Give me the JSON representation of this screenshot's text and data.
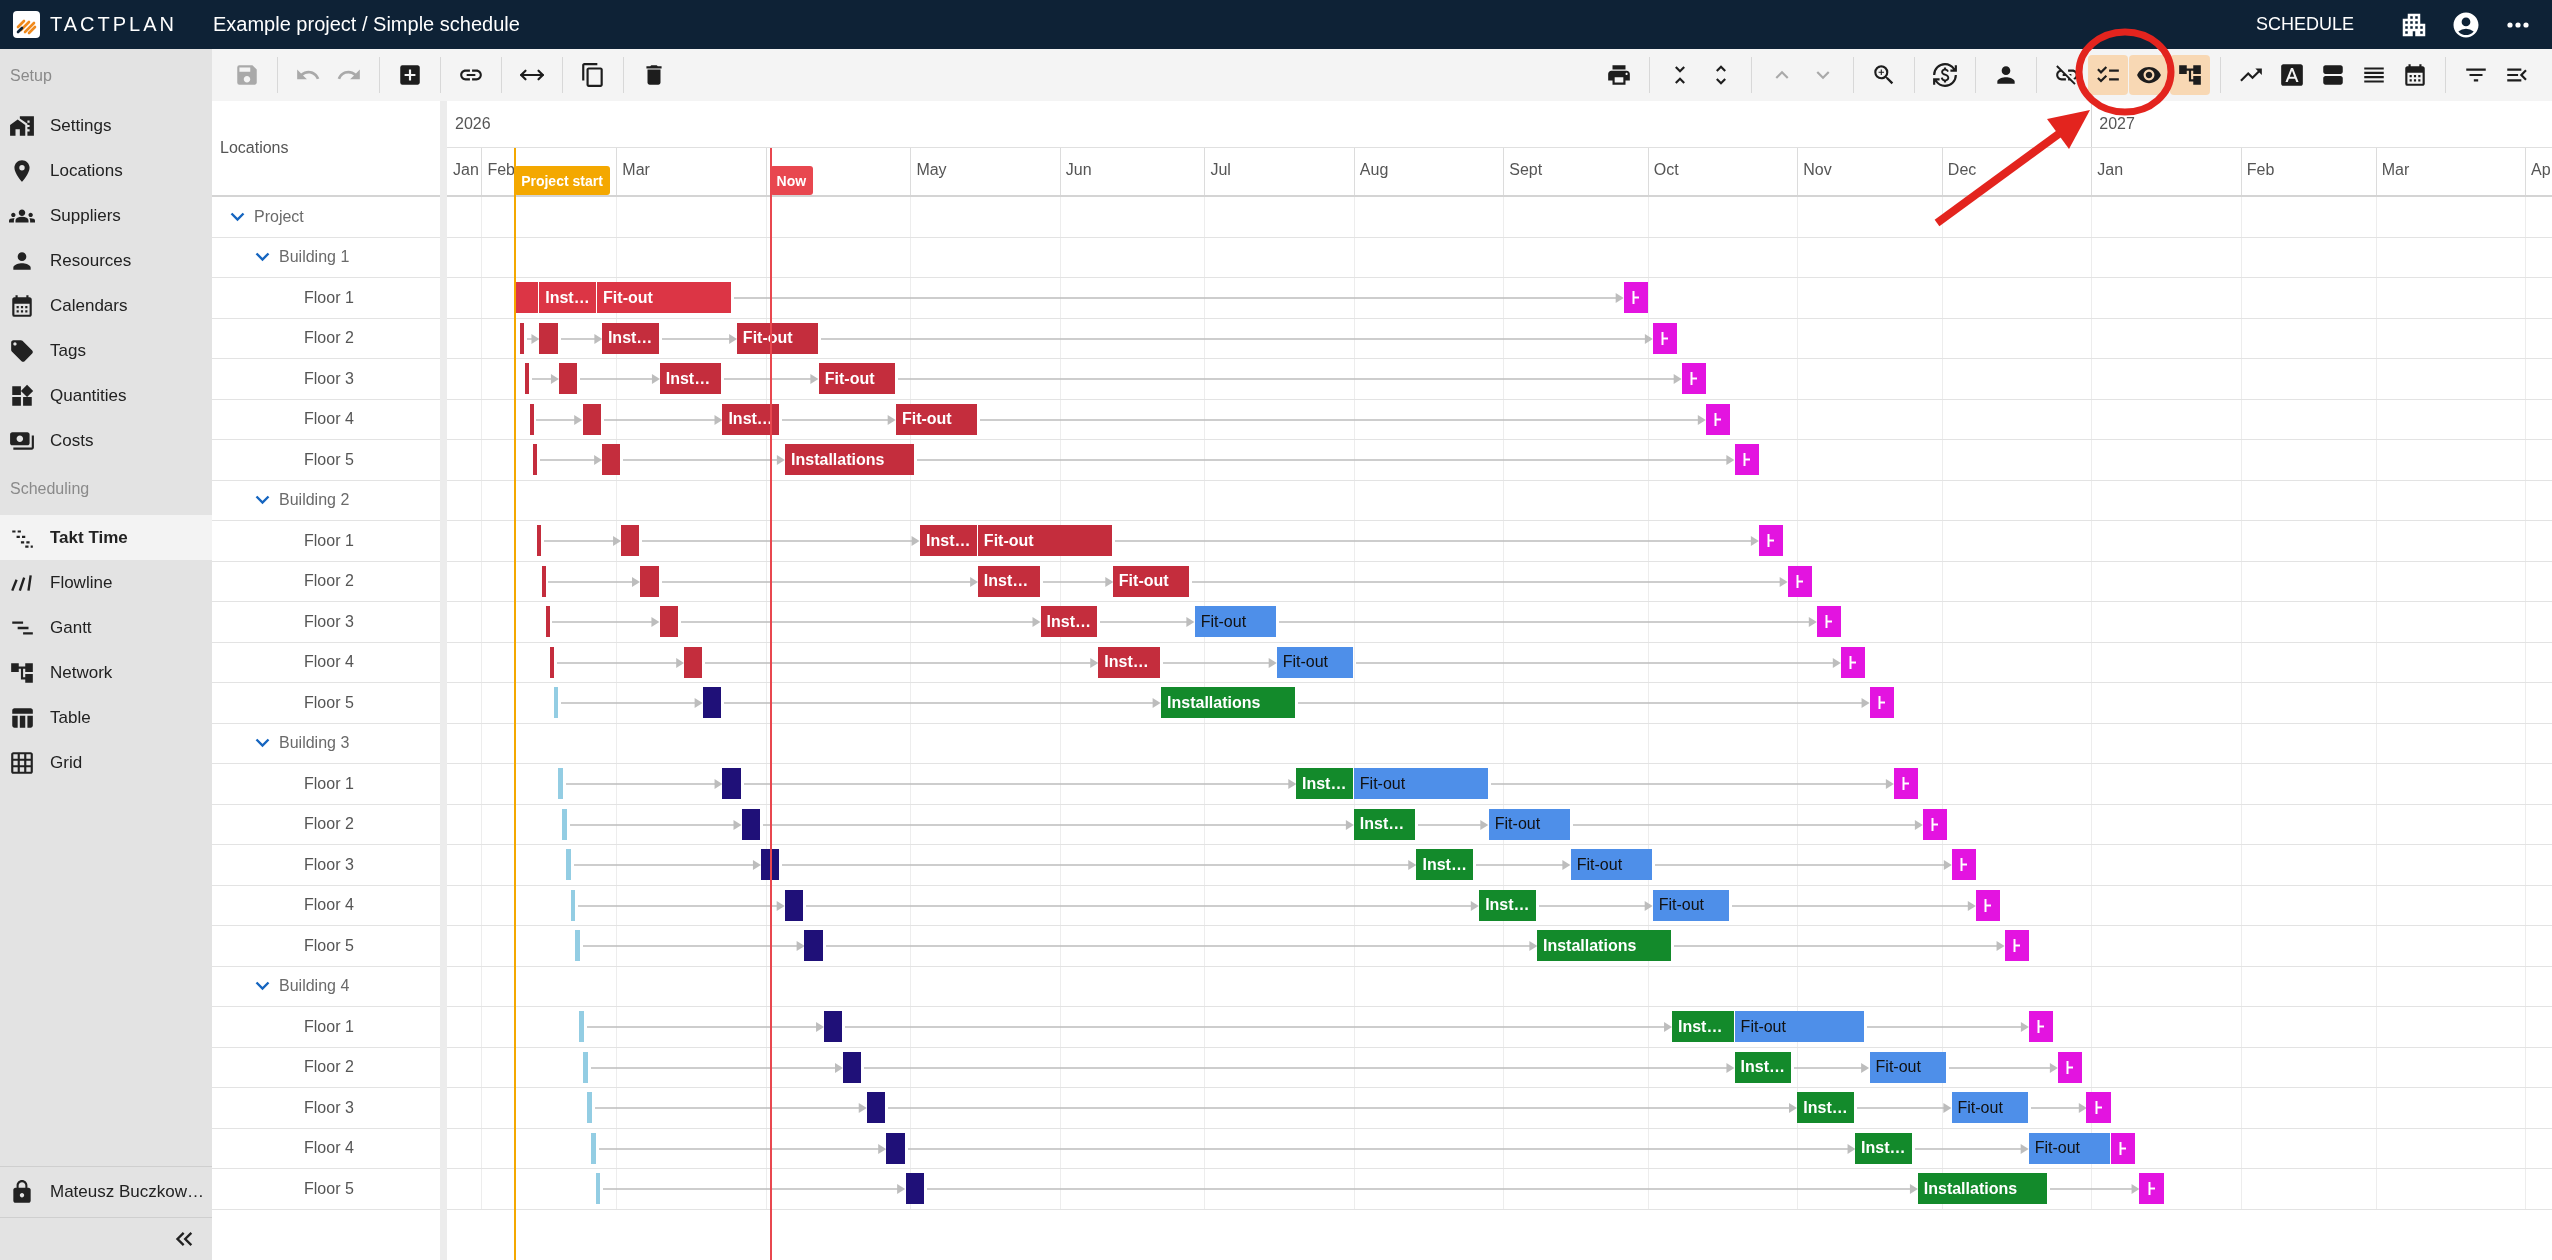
{
  "top_bar": {
    "app_name": "TACTPLAN",
    "title": "Example project / Simple schedule",
    "mode": "SCHEDULE"
  },
  "sidebar": {
    "sections": [
      {
        "title": "Setup",
        "items": [
          {
            "label": "Settings",
            "selected": false
          },
          {
            "label": "Locations",
            "selected": false
          },
          {
            "label": "Suppliers",
            "selected": false
          },
          {
            "label": "Resources",
            "selected": false
          },
          {
            "label": "Calendars",
            "selected": false
          },
          {
            "label": "Tags",
            "selected": false
          },
          {
            "label": "Quantities",
            "selected": false
          },
          {
            "label": "Costs",
            "selected": false
          }
        ]
      },
      {
        "title": "Scheduling",
        "items": [
          {
            "label": "Takt Time",
            "selected": true
          },
          {
            "label": "Flowline",
            "selected": false
          },
          {
            "label": "Gantt",
            "selected": false
          },
          {
            "label": "Network",
            "selected": false
          },
          {
            "label": "Table",
            "selected": false
          },
          {
            "label": "Grid",
            "selected": false
          }
        ]
      }
    ],
    "user": "Mateusz Buczkow…"
  },
  "toolbar": {
    "left": [
      [
        {
          "disabled": true,
          "on": false
        }
      ],
      [
        {
          "disabled": true,
          "on": false
        },
        {
          "disabled": true,
          "on": false
        }
      ],
      [
        {
          "disabled": false,
          "on": false
        }
      ],
      [
        {
          "disabled": false,
          "on": false
        }
      ],
      [
        {
          "disabled": false,
          "on": false
        }
      ],
      [
        {
          "disabled": false,
          "on": false
        }
      ],
      [
        {
          "disabled": false,
          "on": false
        }
      ]
    ],
    "right": [
      [
        {
          "disabled": false,
          "on": false
        }
      ],
      [
        {
          "disabled": false,
          "on": false
        },
        {
          "disabled": false,
          "on": false
        }
      ],
      [
        {
          "disabled": true,
          "on": false
        },
        {
          "disabled": true,
          "on": false
        }
      ],
      [
        {
          "disabled": false,
          "on": false
        }
      ],
      [
        {
          "disabled": false,
          "on": false
        }
      ],
      [
        {
          "disabled": false,
          "on": false
        }
      ],
      [
        {
          "disabled": false,
          "on": false
        },
        {
          "disabled": false,
          "on": true
        },
        {
          "disabled": false,
          "on": true
        },
        {
          "disabled": false,
          "on": true
        }
      ],
      [
        {
          "disabled": false,
          "on": false
        },
        {
          "disabled": false,
          "on": false
        },
        {
          "disabled": false,
          "on": false
        },
        {
          "disabled": false,
          "on": false
        },
        {
          "disabled": false,
          "on": false
        }
      ],
      [
        {
          "disabled": false,
          "on": false
        },
        {
          "disabled": false,
          "on": false
        }
      ]
    ]
  },
  "locations_header": "Locations",
  "timeline": {
    "years": [
      "2026",
      "2027"
    ],
    "months": [
      "Jan",
      "Feb",
      "Mar",
      "May",
      "Jun",
      "Jul",
      "Aug",
      "Sept",
      "Oct",
      "Nov",
      "Dec",
      "Jan",
      "Feb",
      "Mar",
      "Ap"
    ],
    "markers": [
      {
        "label": "Project start",
        "color": "#f4a800"
      },
      {
        "label": "Now",
        "color": "#e8474f"
      }
    ]
  },
  "locations": [
    {
      "label": "Project",
      "expanded": true,
      "children": [
        {
          "label": "Building 1",
          "expanded": true,
          "children": [
            {
              "label": "Floor 1",
              "bars": [
                {
                  "kind": "task",
                  "color": "#dc3545"
                },
                {
                  "kind": "task",
                  "label": "Inst…",
                  "color": "#dc3545"
                },
                {
                  "kind": "task",
                  "label": "Fit-out",
                  "color": "#dc3545"
                },
                {
                  "kind": "milestone",
                  "color": "#e314e0"
                }
              ]
            },
            {
              "label": "Floor 2",
              "bars": [
                {
                  "kind": "task",
                  "color": "#c42d3d"
                },
                {
                  "kind": "task",
                  "color": "#c42d3d"
                },
                {
                  "kind": "task",
                  "label": "Inst…",
                  "color": "#c42d3d"
                },
                {
                  "kind": "task",
                  "label": "Fit-out",
                  "color": "#c42d3d"
                },
                {
                  "kind": "milestone",
                  "color": "#e314e0"
                }
              ]
            },
            {
              "label": "Floor 3",
              "bars": [
                {
                  "kind": "task",
                  "color": "#c42d3d"
                },
                {
                  "kind": "task",
                  "color": "#c42d3d"
                },
                {
                  "kind": "task",
                  "label": "Inst…",
                  "color": "#c42d3d"
                },
                {
                  "kind": "task",
                  "label": "Fit-out",
                  "color": "#c42d3d"
                },
                {
                  "kind": "milestone",
                  "color": "#e314e0"
                }
              ]
            },
            {
              "label": "Floor 4",
              "bars": [
                {
                  "kind": "task",
                  "color": "#c42d3d"
                },
                {
                  "kind": "task",
                  "color": "#c42d3d"
                },
                {
                  "kind": "task",
                  "label": "Inst…",
                  "color": "#c42d3d"
                },
                {
                  "kind": "task",
                  "label": "Fit-out",
                  "color": "#c42d3d"
                },
                {
                  "kind": "milestone",
                  "color": "#e314e0"
                }
              ]
            },
            {
              "label": "Floor 5",
              "bars": [
                {
                  "kind": "task",
                  "color": "#c42d3d"
                },
                {
                  "kind": "task",
                  "color": "#c42d3d"
                },
                {
                  "kind": "task",
                  "label": "Installations",
                  "color": "#c42d3d"
                },
                {
                  "kind": "milestone",
                  "color": "#e314e0"
                }
              ]
            }
          ]
        },
        {
          "label": "Building 2",
          "expanded": true,
          "children": [
            {
              "label": "Floor 1",
              "bars": [
                {
                  "kind": "task",
                  "color": "#c42d3d"
                },
                {
                  "kind": "task",
                  "color": "#c42d3d"
                },
                {
                  "kind": "task",
                  "label": "Inst…",
                  "color": "#c42d3d"
                },
                {
                  "kind": "task",
                  "label": "Fit-out",
                  "color": "#c42d3d"
                },
                {
                  "kind": "milestone",
                  "color": "#e314e0"
                }
              ]
            },
            {
              "label": "Floor 2",
              "bars": [
                {
                  "kind": "task",
                  "color": "#c42d3d"
                },
                {
                  "kind": "task",
                  "color": "#c42d3d"
                },
                {
                  "kind": "task",
                  "label": "Inst…",
                  "color": "#c42d3d"
                },
                {
                  "kind": "task",
                  "label": "Fit-out",
                  "color": "#c42d3d"
                },
                {
                  "kind": "milestone",
                  "color": "#e314e0"
                }
              ]
            },
            {
              "label": "Floor 3",
              "bars": [
                {
                  "kind": "task",
                  "color": "#c42d3d"
                },
                {
                  "kind": "task",
                  "color": "#c42d3d"
                },
                {
                  "kind": "task",
                  "label": "Inst…",
                  "color": "#c42d3d"
                },
                {
                  "kind": "task",
                  "label": "Fit-out",
                  "color": "#4e8fe9"
                },
                {
                  "kind": "milestone",
                  "color": "#e314e0"
                }
              ]
            },
            {
              "label": "Floor 4",
              "bars": [
                {
                  "kind": "task",
                  "color": "#c42d3d"
                },
                {
                  "kind": "task",
                  "color": "#c42d3d"
                },
                {
                  "kind": "task",
                  "label": "Inst…",
                  "color": "#c42d3d"
                },
                {
                  "kind": "task",
                  "label": "Fit-out",
                  "color": "#4e8fe9"
                },
                {
                  "kind": "milestone",
                  "color": "#e314e0"
                }
              ]
            },
            {
              "label": "Floor 5",
              "bars": [
                {
                  "kind": "task",
                  "color": "#93cde3"
                },
                {
                  "kind": "task",
                  "color": "#1f1078"
                },
                {
                  "kind": "task",
                  "label": "Installations",
                  "color": "#138a2b"
                },
                {
                  "kind": "milestone",
                  "color": "#e314e0"
                }
              ]
            }
          ]
        },
        {
          "label": "Building 3",
          "expanded": true,
          "children": [
            {
              "label": "Floor 1",
              "bars": [
                {
                  "kind": "task",
                  "color": "#93cde3"
                },
                {
                  "kind": "task",
                  "color": "#1f1078"
                },
                {
                  "kind": "task",
                  "label": "Inst…",
                  "color": "#138a2b"
                },
                {
                  "kind": "task",
                  "label": "Fit-out",
                  "color": "#4e8fe9"
                },
                {
                  "kind": "milestone",
                  "color": "#e314e0"
                }
              ]
            },
            {
              "label": "Floor 2",
              "bars": [
                {
                  "kind": "task",
                  "color": "#93cde3"
                },
                {
                  "kind": "task",
                  "color": "#1f1078"
                },
                {
                  "kind": "task",
                  "label": "Inst…",
                  "color": "#138a2b"
                },
                {
                  "kind": "task",
                  "label": "Fit-out",
                  "color": "#4e8fe9"
                },
                {
                  "kind": "milestone",
                  "color": "#e314e0"
                }
              ]
            },
            {
              "label": "Floor 3",
              "bars": [
                {
                  "kind": "task",
                  "color": "#93cde3"
                },
                {
                  "kind": "task",
                  "color": "#1f1078"
                },
                {
                  "kind": "task",
                  "label": "Inst…",
                  "color": "#138a2b"
                },
                {
                  "kind": "task",
                  "label": "Fit-out",
                  "color": "#4e8fe9"
                },
                {
                  "kind": "milestone",
                  "color": "#e314e0"
                }
              ]
            },
            {
              "label": "Floor 4",
              "bars": [
                {
                  "kind": "task",
                  "color": "#93cde3"
                },
                {
                  "kind": "task",
                  "color": "#1f1078"
                },
                {
                  "kind": "task",
                  "label": "Inst…",
                  "color": "#138a2b"
                },
                {
                  "kind": "task",
                  "label": "Fit-out",
                  "color": "#4e8fe9"
                },
                {
                  "kind": "milestone",
                  "color": "#e314e0"
                }
              ]
            },
            {
              "label": "Floor 5",
              "bars": [
                {
                  "kind": "task",
                  "color": "#93cde3"
                },
                {
                  "kind": "task",
                  "color": "#1f1078"
                },
                {
                  "kind": "task",
                  "label": "Installations",
                  "color": "#138a2b"
                },
                {
                  "kind": "milestone",
                  "color": "#e314e0"
                }
              ]
            }
          ]
        },
        {
          "label": "Building 4",
          "expanded": true,
          "children": [
            {
              "label": "Floor 1",
              "bars": [
                {
                  "kind": "task",
                  "color": "#93cde3"
                },
                {
                  "kind": "task",
                  "color": "#1f1078"
                },
                {
                  "kind": "task",
                  "label": "Inst…",
                  "color": "#138a2b"
                },
                {
                  "kind": "task",
                  "label": "Fit-out",
                  "color": "#4e8fe9"
                },
                {
                  "kind": "milestone",
                  "color": "#e314e0"
                }
              ]
            },
            {
              "label": "Floor 2",
              "bars": [
                {
                  "kind": "task",
                  "color": "#93cde3"
                },
                {
                  "kind": "task",
                  "color": "#1f1078"
                },
                {
                  "kind": "task",
                  "label": "Inst…",
                  "color": "#138a2b"
                },
                {
                  "kind": "task",
                  "label": "Fit-out",
                  "color": "#4e8fe9"
                },
                {
                  "kind": "milestone",
                  "color": "#e314e0"
                }
              ]
            },
            {
              "label": "Floor 3",
              "bars": [
                {
                  "kind": "task",
                  "color": "#93cde3"
                },
                {
                  "kind": "task",
                  "color": "#1f1078"
                },
                {
                  "kind": "task",
                  "label": "Inst…",
                  "color": "#138a2b"
                },
                {
                  "kind": "task",
                  "label": "Fit-out",
                  "color": "#4e8fe9"
                },
                {
                  "kind": "milestone",
                  "color": "#e314e0"
                }
              ]
            },
            {
              "label": "Floor 4",
              "bars": [
                {
                  "kind": "task",
                  "color": "#93cde3"
                },
                {
                  "kind": "task",
                  "color": "#1f1078"
                },
                {
                  "kind": "task",
                  "label": "Inst…",
                  "color": "#138a2b"
                },
                {
                  "kind": "task",
                  "label": "Fit-out",
                  "color": "#4e8fe9"
                },
                {
                  "kind": "milestone",
                  "color": "#e314e0"
                }
              ]
            },
            {
              "label": "Floor 5",
              "bars": [
                {
                  "kind": "task",
                  "color": "#93cde3"
                },
                {
                  "kind": "task",
                  "color": "#1f1078"
                },
                {
                  "kind": "task",
                  "label": "Installations",
                  "color": "#138a2b"
                },
                {
                  "kind": "milestone",
                  "color": "#e314e0"
                }
              ]
            }
          ]
        }
      ]
    }
  ]
}
